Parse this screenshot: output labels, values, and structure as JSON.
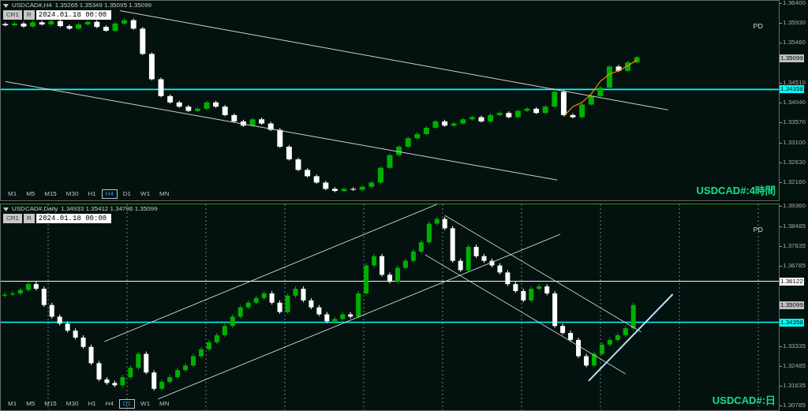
{
  "charts": [
    {
      "header": {
        "symbol": "USDCAD#,H4",
        "ohlc": "1.35265 1.35349 1.35095 1.35099"
      },
      "toolbar": {
        "buttons": [
          "CR1",
          "R"
        ],
        "date_field": "2024.01.18 00:00"
      },
      "tag": "PD",
      "title": "USDCAD#:4時間",
      "timeframes": [
        {
          "label": "M1",
          "selected": false
        },
        {
          "label": "M5",
          "selected": false
        },
        {
          "label": "M15",
          "selected": false
        },
        {
          "label": "M30",
          "selected": false
        },
        {
          "label": "H1",
          "selected": false
        },
        {
          "label": "H4",
          "selected": true
        },
        {
          "label": "D1",
          "selected": false
        },
        {
          "label": "W1",
          "selected": false
        },
        {
          "label": "MN",
          "selected": false
        }
      ],
      "levels": [
        {
          "label": "1.35099",
          "color": "#c0c0c0"
        },
        {
          "label": "1.34358",
          "color": "#00ffff"
        }
      ],
      "chart_data": {
        "type": "candlestick",
        "ylim": [
          1.3169,
          1.3646
        ],
        "ref_lines": [
          {
            "axis": "y",
            "value": 1.34358,
            "color": "#00ffff"
          }
        ],
        "yticks": [
          {
            "value": 1.364,
            "label": "1.36400"
          },
          {
            "value": 1.3593,
            "label": "1.35930"
          },
          {
            "value": 1.3546,
            "label": "1.35460"
          },
          {
            "value": 1.3451,
            "label": "1.34510"
          },
          {
            "value": 1.3404,
            "label": "1.34040"
          },
          {
            "value": 1.3357,
            "label": "1.33570"
          },
          {
            "value": 1.331,
            "label": "1.33100"
          },
          {
            "value": 1.3263,
            "label": "1.32630"
          },
          {
            "value": 1.3216,
            "label": "1.32160"
          }
        ],
        "categories": [
          null,
          null,
          null,
          null,
          null,
          null,
          null,
          null,
          null,
          null,
          null,
          null,
          null,
          null,
          null,
          null,
          null,
          null,
          null,
          null,
          null,
          null,
          null,
          null,
          null,
          null,
          null,
          null,
          null,
          null,
          null,
          null,
          null,
          null,
          null,
          null,
          null,
          null,
          null,
          null,
          null,
          null,
          null,
          null,
          null,
          null,
          null,
          null,
          null,
          null,
          null,
          null,
          null,
          null,
          null,
          null,
          null,
          null,
          null,
          null,
          null,
          null,
          null,
          null,
          null,
          null,
          null,
          null,
          null,
          null,
          null,
          null,
          null,
          null,
          null,
          null,
          null,
          null,
          null,
          null,
          null,
          null,
          null,
          null,
          null
        ],
        "ohlc": [
          [
            1.3591,
            1.3595,
            1.3585,
            1.3588
          ],
          [
            1.3588,
            1.3596,
            1.3585,
            1.3592
          ],
          [
            1.3592,
            1.3596,
            1.3582,
            1.3585
          ],
          [
            1.3585,
            1.3599,
            1.3582,
            1.3595
          ],
          [
            1.3595,
            1.3599,
            1.3587,
            1.359
          ],
          [
            1.359,
            1.3602,
            1.3587,
            1.3598
          ],
          [
            1.3598,
            1.3602,
            1.3583,
            1.3586
          ],
          [
            1.3586,
            1.359,
            1.3577,
            1.358
          ],
          [
            1.358,
            1.3594,
            1.3577,
            1.359
          ],
          [
            1.359,
            1.36,
            1.3587,
            1.3596
          ],
          [
            1.3596,
            1.36,
            1.3581,
            1.3584
          ],
          [
            1.3584,
            1.3588,
            1.3572,
            1.3575
          ],
          [
            1.3575,
            1.3596,
            1.3572,
            1.3592
          ],
          [
            1.3592,
            1.3604,
            1.3589,
            1.36
          ],
          [
            1.36,
            1.3604,
            1.3577,
            1.358
          ],
          [
            1.358,
            1.3584,
            1.3517,
            1.352
          ],
          [
            1.352,
            1.3524,
            1.3457,
            1.346
          ],
          [
            1.346,
            1.3464,
            1.3417,
            1.342
          ],
          [
            1.342,
            1.3424,
            1.3402,
            1.3405
          ],
          [
            1.3405,
            1.3409,
            1.3392,
            1.3395
          ],
          [
            1.3395,
            1.3399,
            1.3382,
            1.3385
          ],
          [
            1.3385,
            1.3394,
            1.3382,
            1.339
          ],
          [
            1.339,
            1.3409,
            1.3387,
            1.3405
          ],
          [
            1.3405,
            1.3409,
            1.3392,
            1.3395
          ],
          [
            1.3395,
            1.3399,
            1.3372,
            1.3375
          ],
          [
            1.3375,
            1.3379,
            1.3357,
            1.336
          ],
          [
            1.336,
            1.3364,
            1.3347,
            1.335
          ],
          [
            1.335,
            1.3369,
            1.3347,
            1.3365
          ],
          [
            1.3365,
            1.3369,
            1.3352,
            1.3355
          ],
          [
            1.3355,
            1.3359,
            1.3337,
            1.334
          ],
          [
            1.334,
            1.3344,
            1.3297,
            1.33
          ],
          [
            1.33,
            1.3304,
            1.3267,
            1.327
          ],
          [
            1.327,
            1.3274,
            1.3242,
            1.3245
          ],
          [
            1.3245,
            1.3249,
            1.3227,
            1.323
          ],
          [
            1.323,
            1.3234,
            1.3212,
            1.3215
          ],
          [
            1.3215,
            1.3219,
            1.3197,
            1.32
          ],
          [
            1.32,
            1.3204,
            1.3192,
            1.3195
          ],
          [
            1.3195,
            1.3204,
            1.3192,
            1.32
          ],
          [
            1.32,
            1.3204,
            1.3195,
            1.3198
          ],
          [
            1.3198,
            1.3209,
            1.3195,
            1.3205
          ],
          [
            1.3205,
            1.3219,
            1.3202,
            1.3215
          ],
          [
            1.3215,
            1.3254,
            1.3212,
            1.325
          ],
          [
            1.325,
            1.3284,
            1.3247,
            1.328
          ],
          [
            1.328,
            1.3304,
            1.3277,
            1.33
          ],
          [
            1.33,
            1.3324,
            1.3297,
            1.332
          ],
          [
            1.332,
            1.3334,
            1.3317,
            1.333
          ],
          [
            1.333,
            1.3349,
            1.3327,
            1.3345
          ],
          [
            1.3345,
            1.3364,
            1.3342,
            1.336
          ],
          [
            1.336,
            1.3364,
            1.3347,
            1.335
          ],
          [
            1.335,
            1.3359,
            1.3347,
            1.3355
          ],
          [
            1.3355,
            1.3369,
            1.3352,
            1.3365
          ],
          [
            1.3365,
            1.3374,
            1.3362,
            1.337
          ],
          [
            1.337,
            1.3374,
            1.3357,
            1.336
          ],
          [
            1.336,
            1.3379,
            1.3357,
            1.3375
          ],
          [
            1.3375,
            1.3384,
            1.3372,
            1.338
          ],
          [
            1.338,
            1.3384,
            1.3367,
            1.337
          ],
          [
            1.337,
            1.3389,
            1.3367,
            1.3385
          ],
          [
            1.3385,
            1.3394,
            1.3382,
            1.339
          ],
          [
            1.339,
            1.3394,
            1.3377,
            1.338
          ],
          [
            1.338,
            1.3399,
            1.3377,
            1.3395
          ],
          [
            1.3395,
            1.3434,
            1.3392,
            1.343
          ],
          [
            1.343,
            1.3434,
            1.3372,
            1.3375
          ],
          [
            1.3375,
            1.3379,
            1.3367,
            1.337
          ],
          [
            1.337,
            1.3404,
            1.3367,
            1.34
          ],
          [
            1.34,
            1.3424,
            1.3397,
            1.342
          ],
          [
            1.342,
            1.3444,
            1.3417,
            1.344
          ],
          [
            1.344,
            1.3494,
            1.3437,
            1.349
          ],
          [
            1.349,
            1.3494,
            1.3477,
            1.348
          ],
          [
            1.348,
            1.3504,
            1.3477,
            1.35
          ],
          [
            1.35,
            1.3516,
            1.3497,
            1.3512
          ],
          null,
          null,
          null,
          null,
          null,
          null,
          null,
          null,
          null,
          null,
          null,
          null,
          null,
          null,
          null
        ]
      }
    },
    {
      "header": {
        "symbol": "USDCAD#,Daily",
        "ohlc": "1.34933 1.35412 1.34796 1.35099"
      },
      "toolbar": {
        "buttons": [
          "CR1",
          "R"
        ],
        "date_field": "2024.01.18 00:00"
      },
      "tag": "PD",
      "title": "USDCAD#:日",
      "timeframes": [
        {
          "label": "M1",
          "selected": false
        },
        {
          "label": "M5",
          "selected": false
        },
        {
          "label": "M15",
          "selected": false
        },
        {
          "label": "M30",
          "selected": false
        },
        {
          "label": "H1",
          "selected": false
        },
        {
          "label": "H4",
          "selected": false
        },
        {
          "label": "D1",
          "selected": true
        },
        {
          "label": "W1",
          "selected": false
        },
        {
          "label": "MN",
          "selected": false
        }
      ],
      "levels": [
        {
          "label": "1.36122",
          "color": "#ffffff"
        },
        {
          "label": "1.35099",
          "color": "#c0c0c0"
        },
        {
          "label": "1.34358",
          "color": "#00ffff"
        }
      ],
      "chart_data": {
        "type": "candlestick",
        "grid": true,
        "ylim": [
          1.3051,
          1.3943
        ],
        "ref_lines": [
          {
            "axis": "y",
            "value": 1.36122,
            "color": "#ffffff"
          },
          {
            "axis": "y",
            "value": 1.34358,
            "color": "#00ffff"
          }
        ],
        "yticks": [
          {
            "value": 1.3936,
            "label": "1.39360"
          },
          {
            "value": 1.38485,
            "label": "1.38485"
          },
          {
            "value": 1.37635,
            "label": "1.37635"
          },
          {
            "value": 1.36785,
            "label": "1.36785"
          },
          {
            "value": 1.33335,
            "label": "1.33335"
          },
          {
            "value": 1.32485,
            "label": "1.32485"
          },
          {
            "value": 1.31635,
            "label": "1.31635"
          },
          {
            "value": 1.30785,
            "label": "1.30785"
          }
        ],
        "categories": [
          null,
          null,
          null,
          null,
          null,
          null,
          null,
          null,
          null,
          null,
          null,
          null,
          null,
          null,
          null,
          null,
          null,
          null,
          null,
          null,
          null,
          null,
          null,
          null,
          null,
          null,
          null,
          null,
          null,
          null,
          null,
          null,
          null,
          null,
          null,
          null,
          null,
          null,
          null,
          null,
          null,
          null,
          null,
          null,
          null,
          null,
          null,
          null,
          null,
          null,
          null,
          null,
          null,
          null,
          null,
          null,
          null,
          null,
          null,
          null,
          null,
          null,
          null,
          null,
          null,
          null,
          null,
          null,
          null,
          null,
          null,
          null,
          null,
          null,
          null,
          null,
          null,
          null,
          null,
          null,
          null,
          null,
          null,
          null,
          null,
          null,
          null,
          null,
          null,
          null,
          null,
          null,
          null,
          null,
          null,
          null,
          null,
          null,
          null
        ],
        "ohlc": [
          [
            1.355,
            1.3565,
            1.3542,
            1.3555
          ],
          [
            1.3555,
            1.357,
            1.3547,
            1.356
          ],
          [
            1.356,
            1.3585,
            1.3552,
            1.3575
          ],
          [
            1.3575,
            1.361,
            1.3567,
            1.36
          ],
          [
            1.36,
            1.361,
            1.3572,
            1.358
          ],
          [
            1.358,
            1.359,
            1.3502,
            1.351
          ],
          [
            1.351,
            1.352,
            1.3452,
            1.346
          ],
          [
            1.346,
            1.347,
            1.3422,
            1.343
          ],
          [
            1.343,
            1.344,
            1.3392,
            1.34
          ],
          [
            1.34,
            1.341,
            1.3362,
            1.337
          ],
          [
            1.337,
            1.338,
            1.3322,
            1.333
          ],
          [
            1.333,
            1.334,
            1.3252,
            1.326
          ],
          [
            1.326,
            1.327,
            1.3182,
            1.319
          ],
          [
            1.319,
            1.32,
            1.3167,
            1.3175
          ],
          [
            1.3175,
            1.3185,
            1.3157,
            1.3165
          ],
          [
            1.3165,
            1.321,
            1.3157,
            1.32
          ],
          [
            1.32,
            1.325,
            1.3192,
            1.324
          ],
          [
            1.324,
            1.331,
            1.3232,
            1.33
          ],
          [
            1.33,
            1.331,
            1.3212,
            1.322
          ],
          [
            1.322,
            1.323,
            1.3142,
            1.315
          ],
          [
            1.315,
            1.319,
            1.3142,
            1.318
          ],
          [
            1.318,
            1.321,
            1.3172,
            1.32
          ],
          [
            1.32,
            1.324,
            1.3192,
            1.323
          ],
          [
            1.323,
            1.326,
            1.3222,
            1.325
          ],
          [
            1.325,
            1.33,
            1.3242,
            1.329
          ],
          [
            1.329,
            1.333,
            1.3282,
            1.332
          ],
          [
            1.332,
            1.336,
            1.3312,
            1.335
          ],
          [
            1.335,
            1.339,
            1.3342,
            1.338
          ],
          [
            1.338,
            1.343,
            1.3372,
            1.342
          ],
          [
            1.342,
            1.347,
            1.3412,
            1.346
          ],
          [
            1.346,
            1.351,
            1.3452,
            1.35
          ],
          [
            1.35,
            1.353,
            1.3492,
            1.352
          ],
          [
            1.352,
            1.355,
            1.3512,
            1.354
          ],
          [
            1.354,
            1.357,
            1.3532,
            1.356
          ],
          [
            1.356,
            1.357,
            1.3512,
            1.352
          ],
          [
            1.352,
            1.353,
            1.3472,
            1.348
          ],
          [
            1.348,
            1.356,
            1.3472,
            1.355
          ],
          [
            1.355,
            1.359,
            1.3542,
            1.358
          ],
          [
            1.358,
            1.359,
            1.3522,
            1.353
          ],
          [
            1.353,
            1.354,
            1.3492,
            1.35
          ],
          [
            1.35,
            1.351,
            1.3462,
            1.347
          ],
          [
            1.347,
            1.348,
            1.3432,
            1.344
          ],
          [
            1.344,
            1.346,
            1.3432,
            1.345
          ],
          [
            1.345,
            1.348,
            1.3442,
            1.347
          ],
          [
            1.347,
            1.348,
            1.3452,
            1.346
          ],
          [
            1.346,
            1.357,
            1.3452,
            1.356
          ],
          [
            1.356,
            1.369,
            1.3552,
            1.368
          ],
          [
            1.368,
            1.373,
            1.3672,
            1.372
          ],
          [
            1.372,
            1.373,
            1.3632,
            1.364
          ],
          [
            1.364,
            1.365,
            1.3602,
            1.361
          ],
          [
            1.361,
            1.368,
            1.3602,
            1.367
          ],
          [
            1.367,
            1.371,
            1.3662,
            1.37
          ],
          [
            1.37,
            1.375,
            1.3692,
            1.374
          ],
          [
            1.374,
            1.379,
            1.3732,
            1.378
          ],
          [
            1.378,
            1.387,
            1.3772,
            1.386
          ],
          [
            1.386,
            1.389,
            1.3852,
            1.388
          ],
          [
            1.388,
            1.389,
            1.3832,
            1.384
          ],
          [
            1.384,
            1.385,
            1.3692,
            1.37
          ],
          [
            1.37,
            1.371,
            1.3652,
            1.366
          ],
          [
            1.366,
            1.377,
            1.3652,
            1.376
          ],
          [
            1.376,
            1.377,
            1.3712,
            1.372
          ],
          [
            1.372,
            1.373,
            1.3692,
            1.37
          ],
          [
            1.37,
            1.371,
            1.3672,
            1.368
          ],
          [
            1.368,
            1.369,
            1.3642,
            1.365
          ],
          [
            1.365,
            1.366,
            1.3592,
            1.36
          ],
          [
            1.36,
            1.361,
            1.3562,
            1.357
          ],
          [
            1.357,
            1.358,
            1.3522,
            1.353
          ],
          [
            1.353,
            1.359,
            1.3522,
            1.358
          ],
          [
            1.358,
            1.36,
            1.3572,
            1.359
          ],
          [
            1.359,
            1.36,
            1.3552,
            1.356
          ],
          [
            1.356,
            1.357,
            1.3412,
            1.342
          ],
          [
            1.342,
            1.343,
            1.3382,
            1.339
          ],
          [
            1.339,
            1.34,
            1.3352,
            1.336
          ],
          [
            1.336,
            1.337,
            1.3282,
            1.329
          ],
          [
            1.329,
            1.33,
            1.3242,
            1.325
          ],
          [
            1.325,
            1.331,
            1.3242,
            1.33
          ],
          [
            1.33,
            1.335,
            1.3292,
            1.334
          ],
          [
            1.334,
            1.337,
            1.3332,
            1.336
          ],
          [
            1.336,
            1.339,
            1.3352,
            1.338
          ],
          [
            1.338,
            1.342,
            1.3372,
            1.341
          ],
          [
            1.341,
            1.352,
            1.3402,
            1.351
          ],
          null,
          null,
          null,
          null,
          null,
          null,
          null,
          null,
          null,
          null,
          null,
          null,
          null,
          null,
          null,
          null,
          null,
          null
        ]
      }
    }
  ]
}
